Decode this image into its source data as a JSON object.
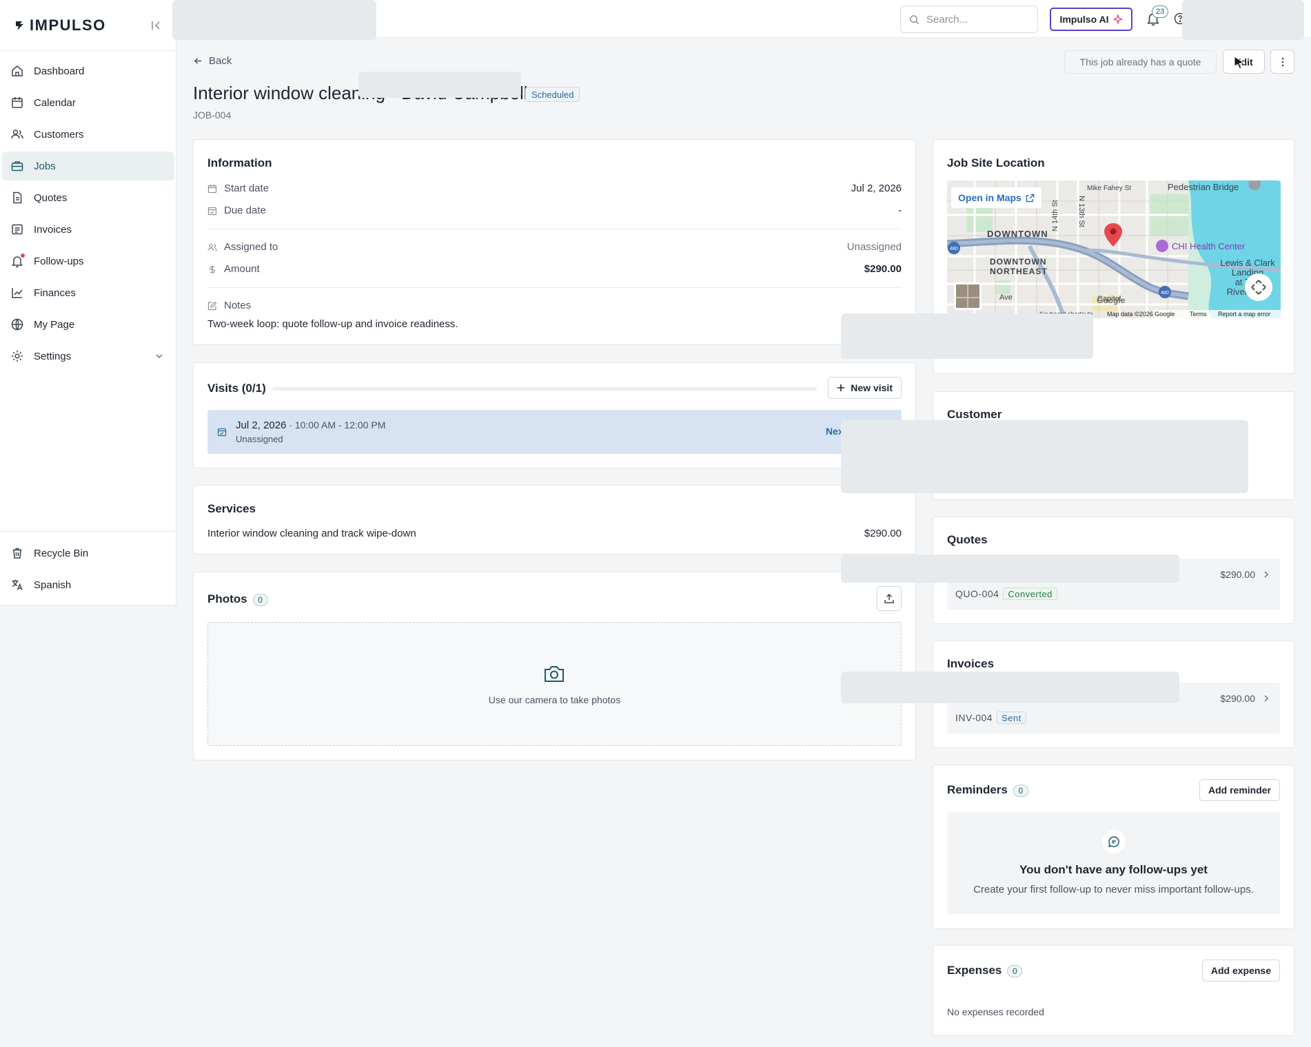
{
  "brand": {
    "name": "IMPULSO"
  },
  "sidebar": {
    "items": [
      {
        "label": "Dashboard",
        "icon": "home-icon"
      },
      {
        "label": "Calendar",
        "icon": "calendar-icon"
      },
      {
        "label": "Customers",
        "icon": "users-icon"
      },
      {
        "label": "Jobs",
        "icon": "briefcase-icon",
        "active": true
      },
      {
        "label": "Quotes",
        "icon": "file-icon"
      },
      {
        "label": "Invoices",
        "icon": "receipt-icon"
      },
      {
        "label": "Follow-ups",
        "icon": "bell-icon"
      },
      {
        "label": "Finances",
        "icon": "chart-icon"
      },
      {
        "label": "My Page",
        "icon": "globe-icon"
      },
      {
        "label": "Settings",
        "icon": "gear-icon"
      }
    ],
    "bottom": [
      {
        "label": "Recycle Bin",
        "icon": "trash-icon"
      },
      {
        "label": "Spanish",
        "icon": "translate-icon"
      }
    ]
  },
  "topbar": {
    "search_placeholder": "Search...",
    "ai_label": "Impulso AI",
    "notifications_count": "23"
  },
  "header": {
    "back_label": "Back",
    "quote_note": "This job already has a quote",
    "edit_label": "Edit",
    "title": "Interior window cleaning - David Campbell",
    "status": "Scheduled",
    "job_id": "JOB-004"
  },
  "information": {
    "heading": "Information",
    "start_label": "Start date",
    "start_value": "Jul 2, 2026",
    "due_label": "Due date",
    "due_value": "-",
    "assigned_label": "Assigned to",
    "assigned_value": "Unassigned",
    "amount_label": "Amount",
    "amount_value": "$290.00",
    "notes_label": "Notes",
    "notes_value": "Two-week loop: quote follow-up and invoice readiness."
  },
  "visits": {
    "heading": "Visits (0/1)",
    "new_label": "New visit",
    "progress": 0,
    "item": {
      "date": "Jul 2, 2026",
      "sep": " · ",
      "time": "10:00 AM - 12:00 PM",
      "assignee": "Unassigned",
      "tag": "Next"
    }
  },
  "services": {
    "heading": "Services",
    "item": "Interior window cleaning and track wipe-down",
    "price": "$290.00"
  },
  "photos": {
    "heading": "Photos",
    "count": "0",
    "empty_text": "Use our camera to take photos"
  },
  "location": {
    "heading": "Job Site Location",
    "open_maps": "Open in Maps",
    "map_labels": {
      "bridge": "Pedestrian Bridge",
      "street1": "Mike Fahey St",
      "downtown": "DOWNTOWN",
      "downtown_ne_1": "DOWNTOWN",
      "downtown_ne_2": "NORTHEAST",
      "poi": "CHI Health Center",
      "landing_1": "Lewis & Clark",
      "landing_2": "Landing",
      "landing_3": "at The",
      "landing_4": "RiverFront",
      "n14": "N 14th St",
      "n13": "N 13th St",
      "ave": "Ave",
      "capitol": "Capitol",
      "shortcuts": "Keyboard shortcuts",
      "mapdata": "Map data ©2026 Google",
      "terms": "Terms",
      "report": "Report a map error",
      "google": "Google",
      "i480": "480",
      "i480b": "480"
    }
  },
  "customer": {
    "heading": "Customer"
  },
  "quotes": {
    "heading": "Quotes",
    "amount": "$290.00",
    "number": "QUO-004",
    "status": "Converted"
  },
  "invoices": {
    "heading": "Invoices",
    "amount": "$290.00",
    "number": "INV-004",
    "status": "Sent"
  },
  "reminders": {
    "heading": "Reminders",
    "count": "0",
    "add_label": "Add reminder",
    "empty_title": "You don't have any follow-ups yet",
    "empty_sub": "Create your first follow-up to never miss important follow-ups."
  },
  "expenses": {
    "heading": "Expenses",
    "count": "0",
    "add_label": "Add expense",
    "empty_text": "No expenses recorded"
  },
  "colors": {
    "accent": "#1c5a6b",
    "ai_border": "#5b3fd1",
    "map_water": "#6fd4e6",
    "map_pin": "#e5484d"
  }
}
